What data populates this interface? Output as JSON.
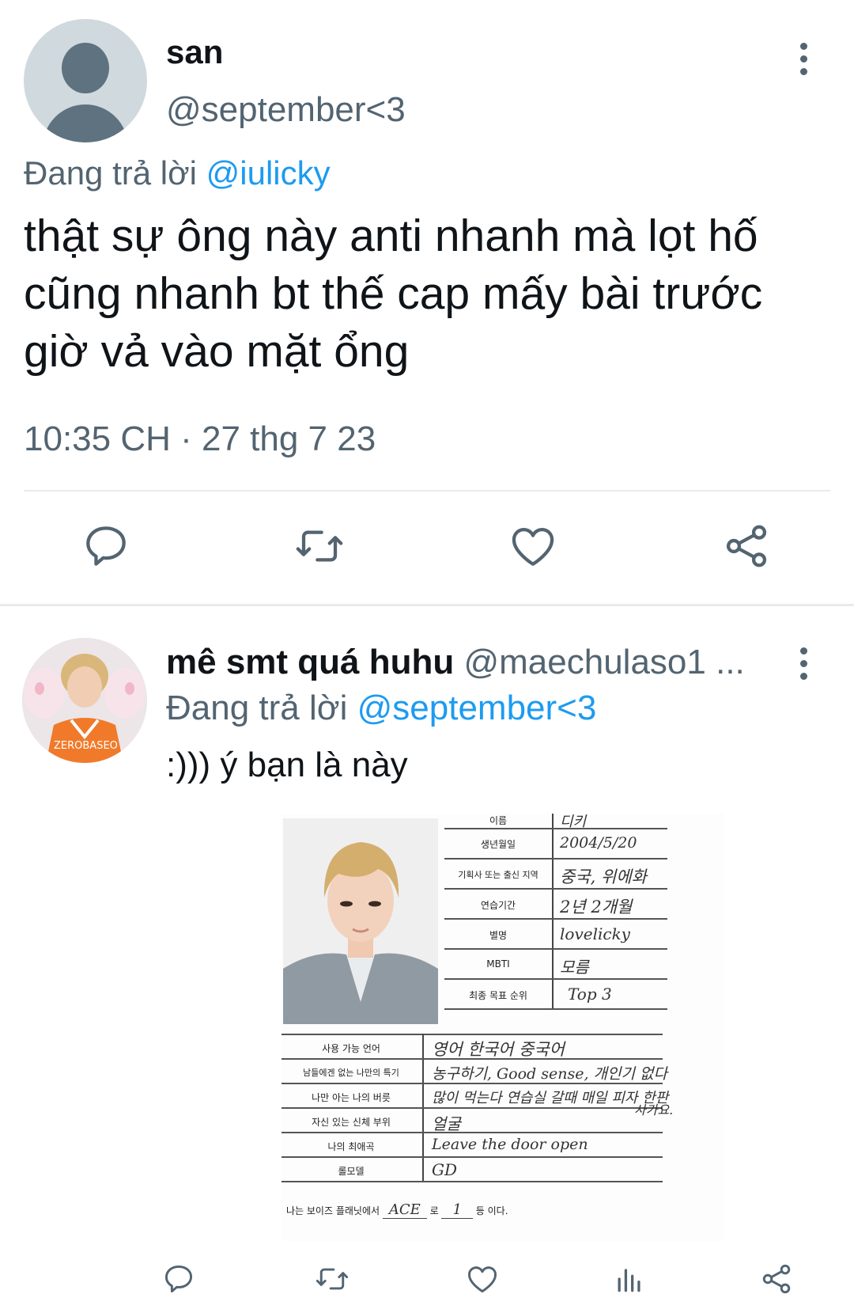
{
  "tweet": {
    "name": "san",
    "handle": "@september<3",
    "reply_prefix": "Đang trả lời",
    "reply_to": "@iulicky",
    "text": "thật sự ông này anti nhanh mà lọt hố cũng nhanh bt thế cap mấy bài trước giờ vả vào mặt ổng",
    "timestamp": "10:35 CH · 27 thg 7 23",
    "actions": [
      "reply-icon",
      "retweet-icon",
      "like-icon",
      "share-icon"
    ]
  },
  "reply": {
    "name": "mê smt quá huhu",
    "handle": "@maechulaso1 ...",
    "reply_prefix": "Đang trả lời",
    "reply_to": "@september<3",
    "text": ":))) ý bạn là này",
    "actions": [
      "reply-icon",
      "retweet-icon",
      "like-icon",
      "analytics-icon",
      "share-icon"
    ]
  },
  "profile_card": {
    "top_rows": [
      {
        "label": "이름",
        "value": "디키"
      },
      {
        "label": "생년월일",
        "value": "2004/5/20"
      },
      {
        "label": "기획사 또는 출신 지역",
        "value": "중국, 위에화"
      },
      {
        "label": "연습기간",
        "value": "2년 2개월"
      },
      {
        "label": "별명",
        "value": "lovelicky"
      },
      {
        "label": "MBTI",
        "value": "모름"
      },
      {
        "label": "최종 목표 순위",
        "value": "Top 3"
      }
    ],
    "bottom_rows": [
      {
        "label": "사용 가능 언어",
        "value": "영어 한국어 중국어"
      },
      {
        "label": "남들에겐 없는 나만의 특기",
        "value": "농구하기, Good sense, 개인기 없다"
      },
      {
        "label": "나만 아는 나의 버릇",
        "value": "많이 먹는다 연습실 갈때 매일 피자 한판"
      },
      {
        "label": "자신 있는 신체 부위",
        "value": "얼굴"
      },
      {
        "label": "나의 최애곡",
        "value": "Leave the door open"
      },
      {
        "label": "롤모델",
        "value": "GD"
      }
    ],
    "overflow_note": "사가요.",
    "footer_prefix": "나는 보이즈 플래닛에서",
    "footer_fill1": "ACE",
    "footer_mid": "로",
    "footer_fill2": "1",
    "footer_suffix": "등 이다."
  }
}
